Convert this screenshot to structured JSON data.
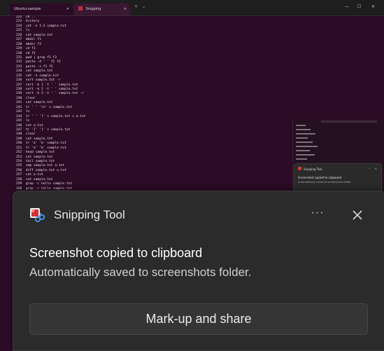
{
  "terminal": {
    "tabs": [
      {
        "label": "Ubuntu-sample"
      },
      {
        "label": "Snipping"
      }
    ],
    "new_tab": "+",
    "dropdown": "⌄",
    "window_controls": [
      "—",
      "☐",
      "✕"
    ],
    "lines": [
      "222  cd ..",
      "223  history",
      "224  cat -n 1-2 sample.txt",
      "225  ls",
      "226  cat sample.txt",
      "227  mkdir f1",
      "228  mkdir f2",
      "229  cd f1",
      "230  cd f2",
      "231  pwd | grep f1 f2",
      "232  paste -d ' ' f1 f2",
      "233  paste -s f1 f2",
      "234  cat sample.txt",
      "235  cat -n sample.txt",
      "236  sort sample.txt -r",
      "237  sort -k 1 -t ' ' sample.txt",
      "238  sort -k 2 -t ' ' sample.txt",
      "239  sort -k 3 -t ' ' sample.txt -r",
      "240  clear",
      "241  cat sample.txt",
      "242  tr ' ' '\\n' < sample.txt",
      "243  ls",
      "244  tr ' ' '[' < sample.txt > a.txt",
      "245  ls",
      "246  cat a.txt",
      "247  tr '[' ']' < sample.txt",
      "248  clear",
      "249  cat sample.txt",
      "250  tr 'a' 'b' sample.txt",
      "251  tr 'a' 'b' sample.txt",
      "252  head sample.txt",
      "253  cat sample.txt",
      "254  tail sample.txt",
      "255  cmp sample.txt a.txt",
      "256  diff sample.txt a.txt",
      "257  cat a.txt",
      "258  cat sample.txt",
      "259  grep -i hello sample.txt",
      "260  grep -c hello sample.txt"
    ]
  },
  "mini_toast": {
    "app_name": "Snipping Tool",
    "headline": "Screenshot copied to clipboard",
    "sub": "Automatically saved to screenshots folder.",
    "more": "···",
    "close": "✕"
  },
  "toast": {
    "app_name": "Snipping Tool",
    "app_icon": "snipping-tool-icon",
    "more_label": "···",
    "close_icon": "close-icon",
    "headline": "Screenshot copied to clipboard",
    "subtext": "Automatically saved to screenshots folder.",
    "action_label": "Mark-up and share"
  },
  "colors": {
    "terminal_bg": "#2c0b26",
    "toast_bg": "#2b2b2b",
    "button_bg": "#353535"
  }
}
